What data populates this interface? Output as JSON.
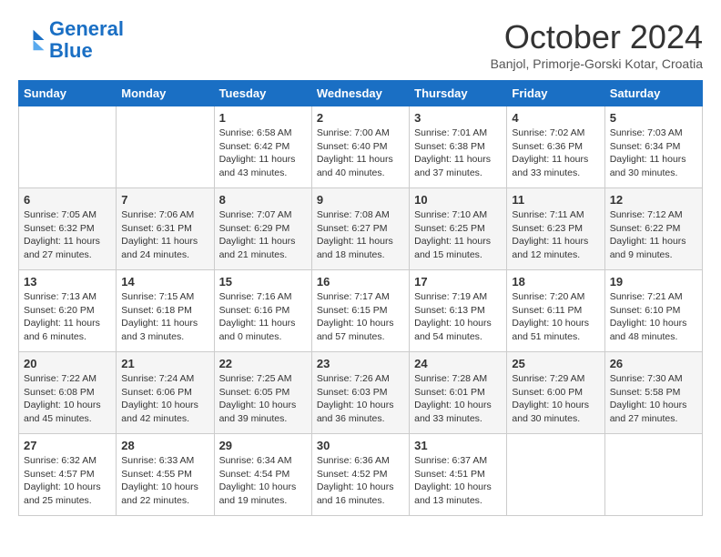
{
  "header": {
    "logo_line1": "General",
    "logo_line2": "Blue",
    "month_year": "October 2024",
    "location": "Banjol, Primorje-Gorski Kotar, Croatia"
  },
  "columns": [
    "Sunday",
    "Monday",
    "Tuesday",
    "Wednesday",
    "Thursday",
    "Friday",
    "Saturday"
  ],
  "weeks": [
    [
      {
        "day": "",
        "info": ""
      },
      {
        "day": "",
        "info": ""
      },
      {
        "day": "1",
        "info": "Sunrise: 6:58 AM\nSunset: 6:42 PM\nDaylight: 11 hours and 43 minutes."
      },
      {
        "day": "2",
        "info": "Sunrise: 7:00 AM\nSunset: 6:40 PM\nDaylight: 11 hours and 40 minutes."
      },
      {
        "day": "3",
        "info": "Sunrise: 7:01 AM\nSunset: 6:38 PM\nDaylight: 11 hours and 37 minutes."
      },
      {
        "day": "4",
        "info": "Sunrise: 7:02 AM\nSunset: 6:36 PM\nDaylight: 11 hours and 33 minutes."
      },
      {
        "day": "5",
        "info": "Sunrise: 7:03 AM\nSunset: 6:34 PM\nDaylight: 11 hours and 30 minutes."
      }
    ],
    [
      {
        "day": "6",
        "info": "Sunrise: 7:05 AM\nSunset: 6:32 PM\nDaylight: 11 hours and 27 minutes."
      },
      {
        "day": "7",
        "info": "Sunrise: 7:06 AM\nSunset: 6:31 PM\nDaylight: 11 hours and 24 minutes."
      },
      {
        "day": "8",
        "info": "Sunrise: 7:07 AM\nSunset: 6:29 PM\nDaylight: 11 hours and 21 minutes."
      },
      {
        "day": "9",
        "info": "Sunrise: 7:08 AM\nSunset: 6:27 PM\nDaylight: 11 hours and 18 minutes."
      },
      {
        "day": "10",
        "info": "Sunrise: 7:10 AM\nSunset: 6:25 PM\nDaylight: 11 hours and 15 minutes."
      },
      {
        "day": "11",
        "info": "Sunrise: 7:11 AM\nSunset: 6:23 PM\nDaylight: 11 hours and 12 minutes."
      },
      {
        "day": "12",
        "info": "Sunrise: 7:12 AM\nSunset: 6:22 PM\nDaylight: 11 hours and 9 minutes."
      }
    ],
    [
      {
        "day": "13",
        "info": "Sunrise: 7:13 AM\nSunset: 6:20 PM\nDaylight: 11 hours and 6 minutes."
      },
      {
        "day": "14",
        "info": "Sunrise: 7:15 AM\nSunset: 6:18 PM\nDaylight: 11 hours and 3 minutes."
      },
      {
        "day": "15",
        "info": "Sunrise: 7:16 AM\nSunset: 6:16 PM\nDaylight: 11 hours and 0 minutes."
      },
      {
        "day": "16",
        "info": "Sunrise: 7:17 AM\nSunset: 6:15 PM\nDaylight: 10 hours and 57 minutes."
      },
      {
        "day": "17",
        "info": "Sunrise: 7:19 AM\nSunset: 6:13 PM\nDaylight: 10 hours and 54 minutes."
      },
      {
        "day": "18",
        "info": "Sunrise: 7:20 AM\nSunset: 6:11 PM\nDaylight: 10 hours and 51 minutes."
      },
      {
        "day": "19",
        "info": "Sunrise: 7:21 AM\nSunset: 6:10 PM\nDaylight: 10 hours and 48 minutes."
      }
    ],
    [
      {
        "day": "20",
        "info": "Sunrise: 7:22 AM\nSunset: 6:08 PM\nDaylight: 10 hours and 45 minutes."
      },
      {
        "day": "21",
        "info": "Sunrise: 7:24 AM\nSunset: 6:06 PM\nDaylight: 10 hours and 42 minutes."
      },
      {
        "day": "22",
        "info": "Sunrise: 7:25 AM\nSunset: 6:05 PM\nDaylight: 10 hours and 39 minutes."
      },
      {
        "day": "23",
        "info": "Sunrise: 7:26 AM\nSunset: 6:03 PM\nDaylight: 10 hours and 36 minutes."
      },
      {
        "day": "24",
        "info": "Sunrise: 7:28 AM\nSunset: 6:01 PM\nDaylight: 10 hours and 33 minutes."
      },
      {
        "day": "25",
        "info": "Sunrise: 7:29 AM\nSunset: 6:00 PM\nDaylight: 10 hours and 30 minutes."
      },
      {
        "day": "26",
        "info": "Sunrise: 7:30 AM\nSunset: 5:58 PM\nDaylight: 10 hours and 27 minutes."
      }
    ],
    [
      {
        "day": "27",
        "info": "Sunrise: 6:32 AM\nSunset: 4:57 PM\nDaylight: 10 hours and 25 minutes."
      },
      {
        "day": "28",
        "info": "Sunrise: 6:33 AM\nSunset: 4:55 PM\nDaylight: 10 hours and 22 minutes."
      },
      {
        "day": "29",
        "info": "Sunrise: 6:34 AM\nSunset: 4:54 PM\nDaylight: 10 hours and 19 minutes."
      },
      {
        "day": "30",
        "info": "Sunrise: 6:36 AM\nSunset: 4:52 PM\nDaylight: 10 hours and 16 minutes."
      },
      {
        "day": "31",
        "info": "Sunrise: 6:37 AM\nSunset: 4:51 PM\nDaylight: 10 hours and 13 minutes."
      },
      {
        "day": "",
        "info": ""
      },
      {
        "day": "",
        "info": ""
      }
    ]
  ]
}
